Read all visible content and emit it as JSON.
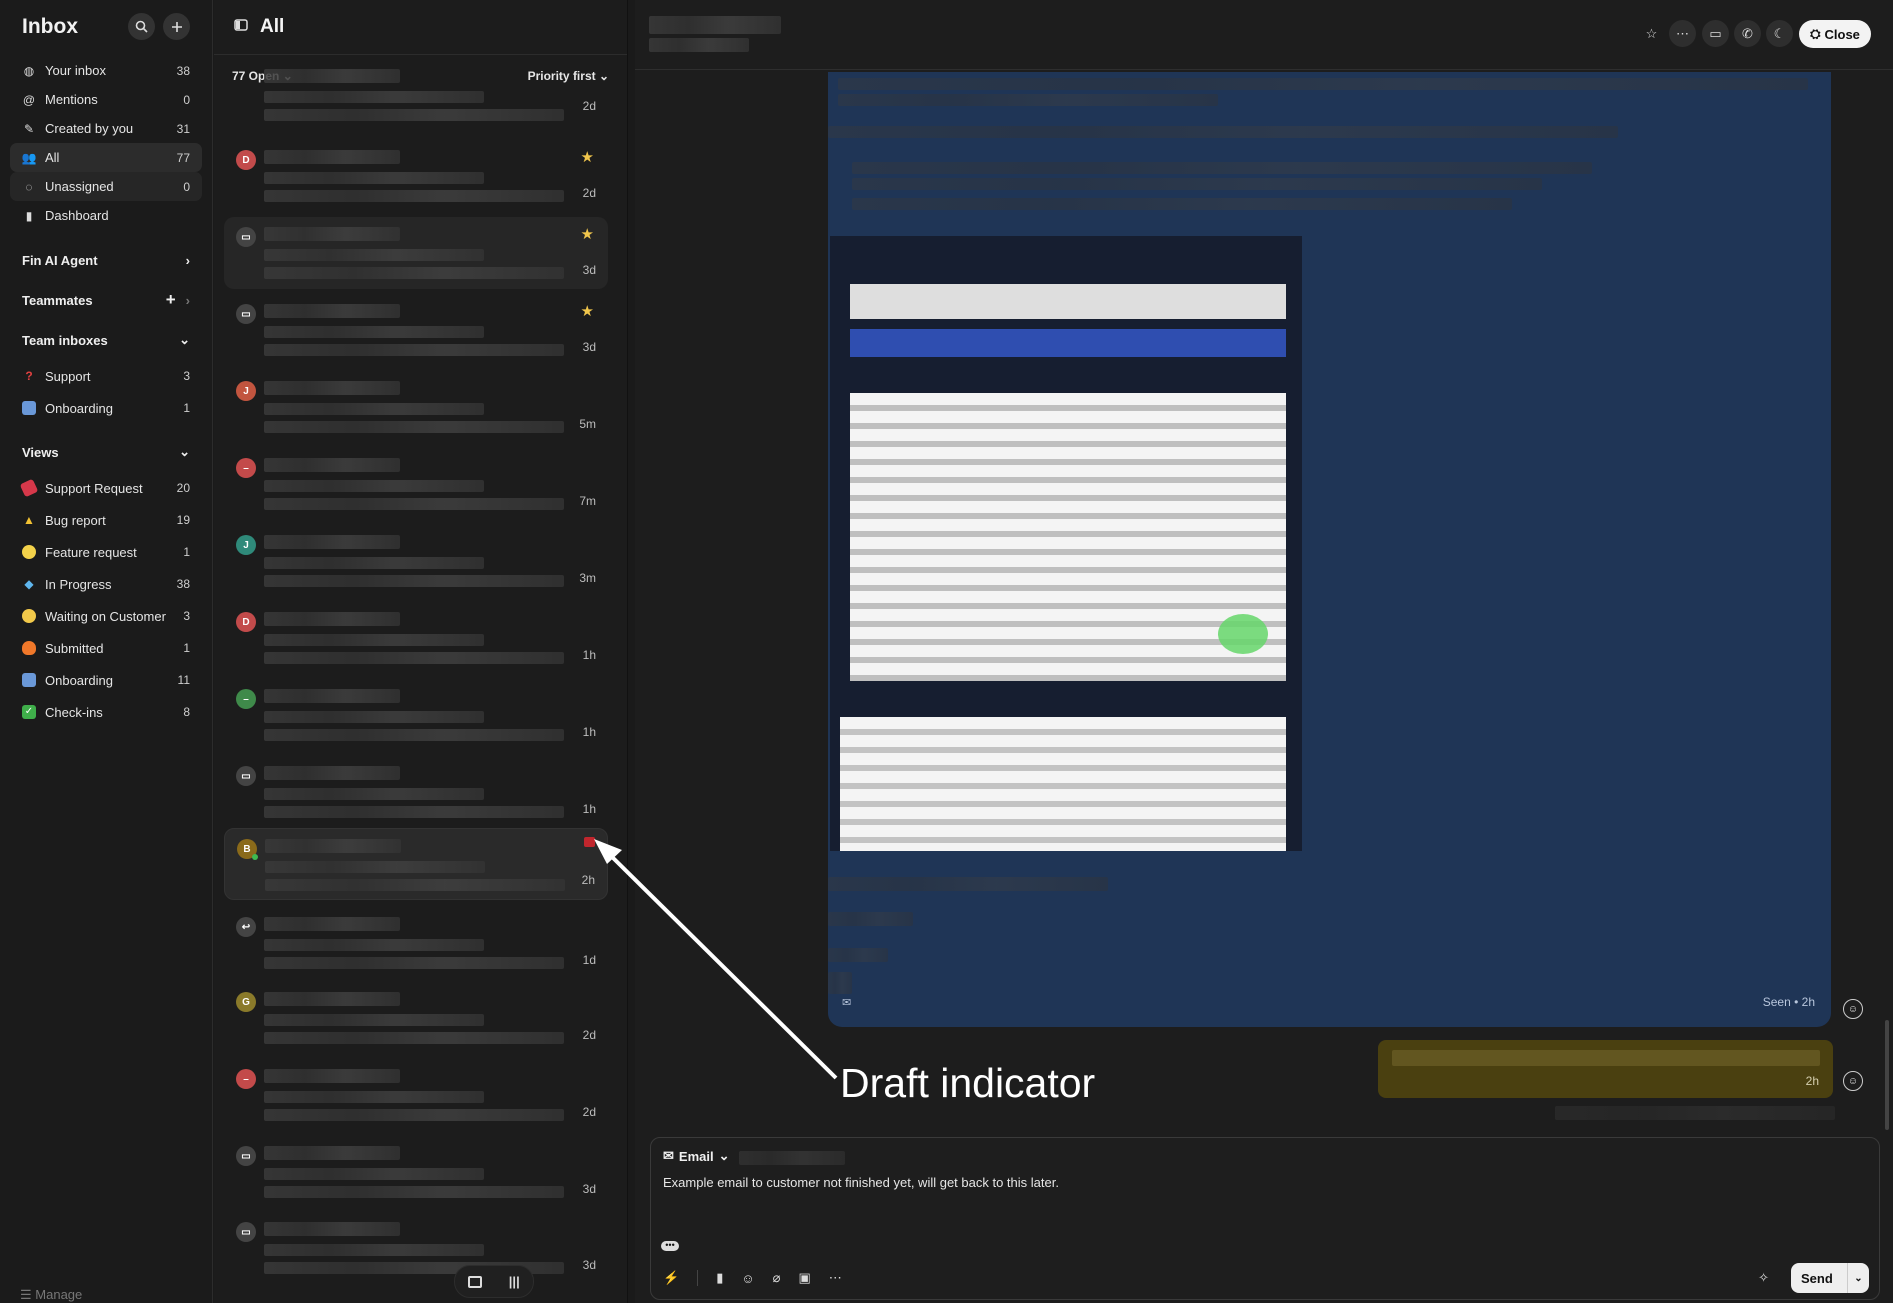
{
  "sidebar": {
    "title": "Inbox",
    "items": [
      {
        "label": "Your inbox",
        "count": "38",
        "icon": "inbox-icon"
      },
      {
        "label": "Mentions",
        "count": "0",
        "icon": "at-icon"
      },
      {
        "label": "Created by you",
        "count": "31",
        "icon": "pen-icon"
      },
      {
        "label": "All",
        "count": "77",
        "icon": "people-icon"
      },
      {
        "label": "Unassigned",
        "count": "0",
        "icon": "unassigned-icon"
      },
      {
        "label": "Dashboard",
        "count": "",
        "icon": "bar-chart-icon"
      }
    ],
    "fin_agent": "Fin AI Agent",
    "teammates": "Teammates",
    "team_inboxes": "Team inboxes",
    "team_items": [
      {
        "label": "Support",
        "count": "3",
        "icon": "question-emoji-icon"
      },
      {
        "label": "Onboarding",
        "count": "1",
        "icon": "ski-emoji-icon"
      }
    ],
    "views": "Views",
    "view_items": [
      {
        "label": "Support Request",
        "count": "20",
        "icon": "ticket-emoji-icon"
      },
      {
        "label": "Bug report",
        "count": "19",
        "icon": "warning-emoji-icon"
      },
      {
        "label": "Feature request",
        "count": "1",
        "icon": "bulb-emoji-icon"
      },
      {
        "label": "In Progress",
        "count": "38",
        "icon": "diamond-emoji-icon"
      },
      {
        "label": "Waiting on Customer",
        "count": "3",
        "icon": "face-emoji-icon"
      },
      {
        "label": "Submitted",
        "count": "1",
        "icon": "fire-emoji-icon"
      },
      {
        "label": "Onboarding",
        "count": "11",
        "icon": "ski-emoji-icon"
      },
      {
        "label": "Check-ins",
        "count": "8",
        "icon": "check-emoji-icon"
      }
    ],
    "footer": "Manage"
  },
  "list": {
    "title": "All",
    "open_filter": "77 Open",
    "sort": "Priority first",
    "conversations": [
      {
        "avatar": "",
        "time": "2d",
        "star": false
      },
      {
        "avatar": "D",
        "time": "2d",
        "star": true
      },
      {
        "avatar": "ticket",
        "time": "3d",
        "star": true
      },
      {
        "avatar": "ticket",
        "time": "3d",
        "star": true
      },
      {
        "avatar": "J",
        "time": "5m",
        "star": false
      },
      {
        "avatar": "–",
        "time": "7m",
        "star": false
      },
      {
        "avatar": "J",
        "time": "3m",
        "star": false
      },
      {
        "avatar": "D",
        "time": "1h",
        "star": false
      },
      {
        "avatar": "–",
        "time": "1h",
        "star": false
      },
      {
        "avatar": "ticket",
        "time": "1h",
        "star": false
      },
      {
        "avatar": "B",
        "time": "2h",
        "star": false
      },
      {
        "avatar": "reply",
        "time": "1d",
        "star": false
      },
      {
        "avatar": "G",
        "time": "2d",
        "star": false
      },
      {
        "avatar": "–",
        "time": "2d",
        "star": false
      },
      {
        "avatar": "ticket",
        "time": "3d",
        "star": false
      },
      {
        "avatar": "ticket",
        "time": "3d",
        "star": false
      }
    ]
  },
  "conversation": {
    "close_label": "Close",
    "seen": "Seen • 2h",
    "reply_time": "2h"
  },
  "composer": {
    "type": "Email",
    "text": "Example email to customer not finished yet, will get back to this later.",
    "send": "Send"
  },
  "annotation": "Draft indicator",
  "colors": {
    "accent_blue": "#1f3556",
    "draft_red": "#c0262d",
    "star": "#f1c64c"
  }
}
